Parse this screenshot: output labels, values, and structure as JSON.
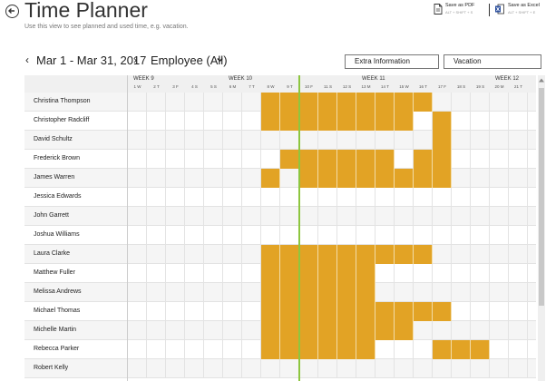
{
  "header": {
    "title": "Time Planner",
    "subtitle": "Use this view to see planned and used time, e.g. vacation."
  },
  "export": {
    "pdf_label": "Save as PDF",
    "pdf_shortcut": "ALT + SHIFT + S",
    "excel_label": "Save as Excel",
    "excel_shortcut": "ALT + SHIFT + E"
  },
  "toolbar": {
    "prev": "‹",
    "range": "Mar 1 - Mar 31, 2017",
    "next": "›",
    "employee_filter": "Employee (All)",
    "extra_info": "Extra Information",
    "vacation": "Vacation"
  },
  "colors": {
    "booked": "#E2A325",
    "today_line": "#8dc63f"
  },
  "weeks": [
    "WEEK 9",
    "WEEK 10",
    "WEEK 11",
    "WEEK 12"
  ],
  "days": [
    "1 W",
    "2 T",
    "3 F",
    "4 S",
    "5 S",
    "6 M",
    "7 T",
    "8 W",
    "9 T",
    "10 F",
    "11 S",
    "12 S",
    "13 M",
    "14 T",
    "15 W",
    "16 T",
    "17 F",
    "18 S",
    "19 S",
    "20 M",
    "21 T"
  ],
  "today_after_day_index": 8,
  "employees": [
    {
      "name": "Christina Thompson",
      "booked": [
        7,
        8,
        9,
        10,
        11,
        12,
        13,
        14,
        15
      ]
    },
    {
      "name": "Christopher Radcliff",
      "booked": [
        7,
        8,
        9,
        10,
        11,
        12,
        13,
        14,
        16
      ]
    },
    {
      "name": "David Schultz",
      "booked": [
        16
      ]
    },
    {
      "name": "Frederick Brown",
      "booked": [
        8,
        9,
        10,
        11,
        12,
        13,
        15,
        16
      ]
    },
    {
      "name": "James Warren",
      "booked": [
        7,
        9,
        10,
        11,
        12,
        13,
        14,
        15,
        16
      ]
    },
    {
      "name": "Jessica Edwards",
      "booked": []
    },
    {
      "name": "John Garrett",
      "booked": []
    },
    {
      "name": "Joshua Williams",
      "booked": []
    },
    {
      "name": "Laura Clarke",
      "booked": [
        7,
        8,
        9,
        10,
        11,
        12,
        13,
        14,
        15
      ]
    },
    {
      "name": "Matthew Fuller",
      "booked": [
        7,
        8,
        9,
        10,
        11,
        12
      ]
    },
    {
      "name": "Melissa Andrews",
      "booked": [
        7,
        8,
        9,
        10,
        11,
        12
      ]
    },
    {
      "name": "Michael Thomas",
      "booked": [
        7,
        8,
        9,
        10,
        11,
        12,
        13,
        14,
        15,
        16
      ]
    },
    {
      "name": "Michelle Martin",
      "booked": [
        7,
        8,
        9,
        10,
        11,
        12,
        13,
        14
      ]
    },
    {
      "name": "Rebecca Parker",
      "booked": [
        7,
        8,
        9,
        10,
        11,
        12,
        16,
        17,
        18
      ]
    },
    {
      "name": "Robert Kelly",
      "booked": []
    }
  ]
}
